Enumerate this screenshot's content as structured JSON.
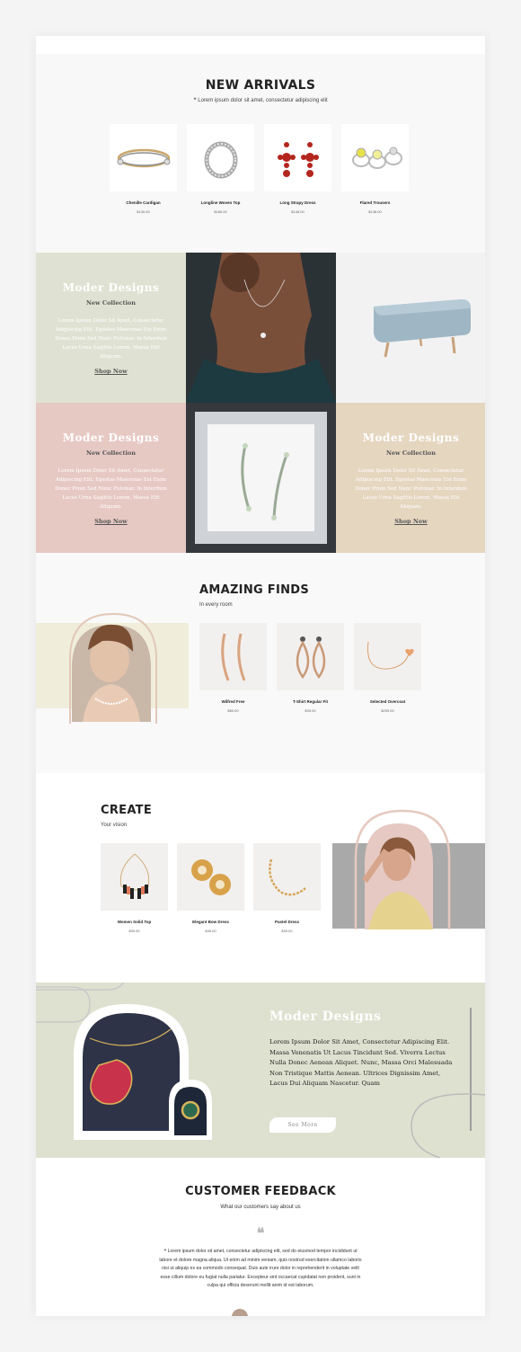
{
  "new_arrivals": {
    "title": "NEW ARRIVALS",
    "subtitle": "❝ Lorem ipsum dolor sit amet, consectetur adipiscing elit",
    "products": [
      {
        "name": "Chenille Cardigan",
        "price": "$130.00",
        "icon": "bangle-bracelet-icon"
      },
      {
        "name": "Longline Woven Top",
        "price": "$180.00",
        "icon": "diamond-ring-icon"
      },
      {
        "name": "Long Strapy Dress",
        "price": "$148.00",
        "icon": "ruby-earrings-icon"
      },
      {
        "name": "Flared Trousers",
        "price": "$138.00",
        "icon": "gem-rings-icon"
      }
    ]
  },
  "tiles": [
    {
      "heading": "Moder Designs",
      "sub": "New Collection",
      "text": "Lorem Ipsum Dolor Sit Amet, Consectetur Adipiscing Elit. Egestas Maecenas Est Enim Donec Proin Sed Nunc Pulvinar. In Interdum Lacus Urna Sagittis Lorem. Massa Elit Aliquam.",
      "link": "Shop Now",
      "bg": "#dfe2d2"
    },
    {
      "heading": "Moder Designs",
      "sub": "New Collection",
      "text": "Lorem Ipsum Dolor Sit Amet, Consectetur Adipiscing Elit. Egestas Maecenas Est Enim Donec Proin Sed Nunc Pulvinar. In Interdum Lacus Urna Sagittis Lorem. Massa Elit Aliquam.",
      "link": "Shop Now",
      "bg": "#e7c9c4"
    },
    {
      "heading": "Moder Designs",
      "sub": "New Collection",
      "text": "Lorem Ipsum Dolor Sit Amet, Consectetur Adipiscing Elit. Egestas Maecenas Est Enim Donec Proin Sed Nunc Pulvinar. In Interdum Lacus Urna Sagittis Lorem. Massa Elit Aliquam.",
      "link": "Shop Now",
      "bg": "#e5d6c0"
    }
  ],
  "amazing_finds": {
    "title": "AMAZING FINDS",
    "subtitle": "In every room",
    "products": [
      {
        "name": "Wilfred Free",
        "price": "$89.00",
        "icon": "hoop-earrings-icon"
      },
      {
        "name": "T-Shirt Regular Fit",
        "price": "$39.00",
        "icon": "drop-earrings-icon"
      },
      {
        "name": "Selected Overcoat",
        "price": "$259.00",
        "icon": "heart-necklace-icon"
      }
    ]
  },
  "create": {
    "title": "CREATE",
    "subtitle": "Your vision",
    "products": [
      {
        "name": "Women Solid Top",
        "price": "$99.00",
        "icon": "statement-necklace-icon"
      },
      {
        "name": "Elegant Bow Dress",
        "price": "$45.00",
        "icon": "gold-earrings-icon"
      },
      {
        "name": "Pastel Dress",
        "price": "$39.00",
        "icon": "gold-bracelet-icon"
      }
    ]
  },
  "banner": {
    "heading": "Moder Designs",
    "text": "Lorem Ipsum Dolor Sit Amet, Consectetur Adipiscing Elit. Massa Venenatis Ut Lacus Tincidunt Sed. Viverra Lectus Nulla Donec Aenean Aliquet. Nunc, Massa Orci Malesuada Non Tristique Mattis Aenean. Ultrices Dignissim Amet, Lacus Dui Aliquam Nascetur. Quam",
    "button": "See More"
  },
  "feedback": {
    "title": "CUSTOMER FEEDBACK",
    "subtitle": "What our customers say about us",
    "quote_mark": "❝",
    "text": "❝ Lorem ipsum dolor sit amet, consectetur adipiscing elit, sed do eiusmod tempor incididunt ut labore et dolore magna aliqua. Ut enim ad minim veniam, quis nostrud exercitation ullamco laboris nisi ut aliquip ex ea commodo consequat. Duis aute irure dolor in reprehenderit in voluptate velit esse cillum dolore eu fugiat nulla pariatur. Excepteur sint occaecat cupidatat non proident, sunt in culpa qui officia deserunt mollit anim id est laborum."
  },
  "colors": {
    "sage": "#dfe1d0",
    "blush": "#e7c9c4",
    "sand": "#e5d6c0",
    "cream": "#f0eedb"
  }
}
